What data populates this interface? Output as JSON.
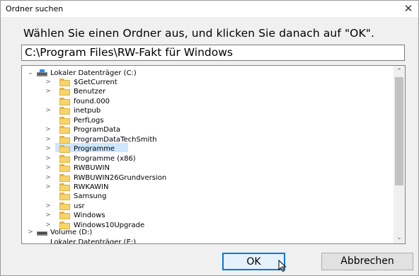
{
  "window": {
    "title": "Ordner suchen",
    "close_glyph": "✕"
  },
  "prompt": "Wählen Sie einen Ordner aus, und klicken Sie danach auf \"OK\".",
  "path_value": "C:\\Program Files\\RW-Fakt für Windows",
  "tree": {
    "root": {
      "label": "Lokaler Datenträger (C:)",
      "expanded": true,
      "icon": "drive-icon"
    },
    "folders": [
      {
        "label": "$GetCurrent",
        "has_children": true
      },
      {
        "label": "Benutzer",
        "has_children": true
      },
      {
        "label": "found.000",
        "has_children": false
      },
      {
        "label": "inetpub",
        "has_children": true
      },
      {
        "label": "PerfLogs",
        "has_children": false
      },
      {
        "label": "ProgramData",
        "has_children": true
      },
      {
        "label": "ProgramDataTechSmith",
        "has_children": true
      },
      {
        "label": "Programme",
        "has_children": true,
        "selected": true
      },
      {
        "label": "Programme (x86)",
        "has_children": true
      },
      {
        "label": "RWBUWIN",
        "has_children": true
      },
      {
        "label": "RWBUWIN26Grundversion",
        "has_children": true
      },
      {
        "label": "RWKAWIN",
        "has_children": true
      },
      {
        "label": "Samsung",
        "has_children": false
      },
      {
        "label": "usr",
        "has_children": true
      },
      {
        "label": "Windows",
        "has_children": true
      },
      {
        "label": "Windows10Upgrade",
        "has_children": true
      }
    ],
    "volume": {
      "label": "Volume (D:)",
      "icon": "drive-icon"
    },
    "partial": {
      "label": "Lokaler Datenträger (E:)"
    }
  },
  "buttons": {
    "ok": "OK",
    "cancel": "Abbrechen"
  },
  "colors": {
    "selection": "#cce8ff",
    "accent": "#0078d7",
    "folder": "#f7d36b"
  }
}
